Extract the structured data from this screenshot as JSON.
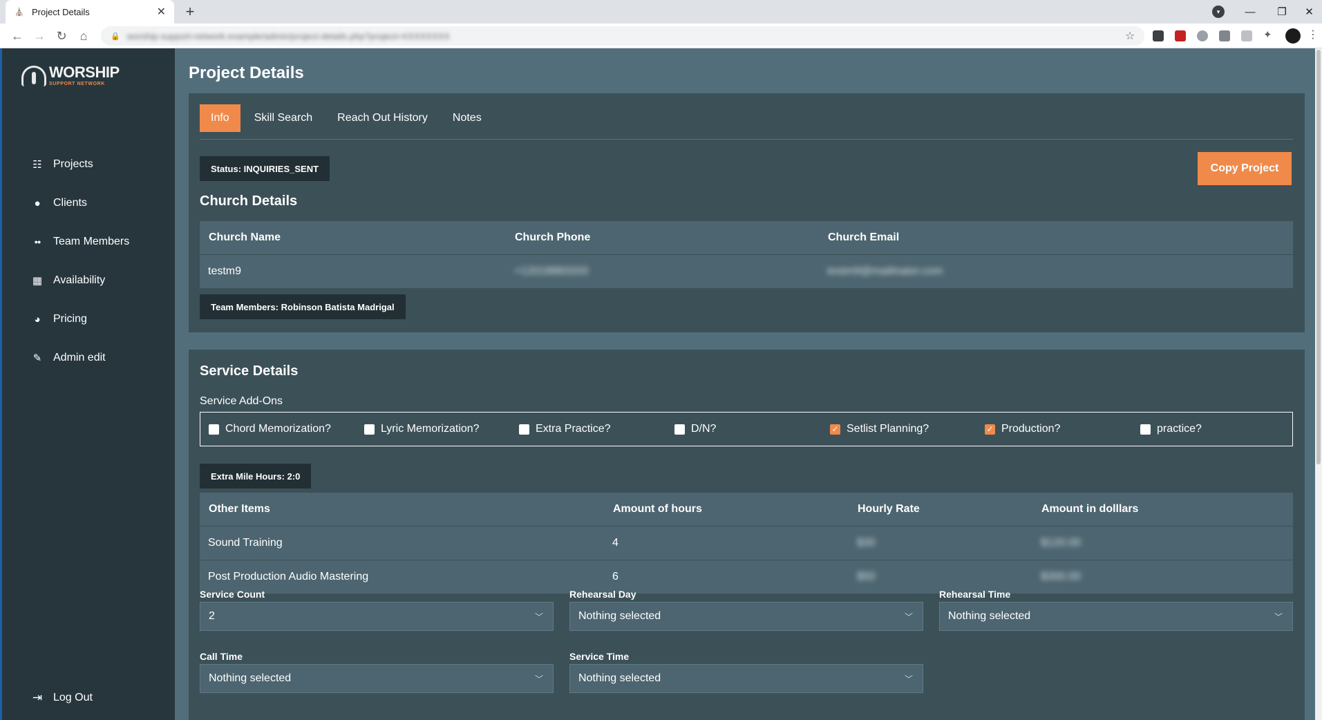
{
  "browser": {
    "tab_title": "Project Details",
    "tab_close": "✕",
    "new_tab": "+",
    "url": "worship-support-network.example/admin/project-details.php?project=XXXXXXXX",
    "window": {
      "minimize": "—",
      "restore": "❐",
      "close": "✕"
    }
  },
  "sidebar": {
    "logo_word": "WORSHIP",
    "logo_sub": "SUPPORT NETWORK",
    "items": [
      {
        "label": "Projects",
        "icon": "projects-icon",
        "glyph": "☷"
      },
      {
        "label": "Clients",
        "icon": "person-icon",
        "glyph": "●"
      },
      {
        "label": "Team Members",
        "icon": "people-icon",
        "glyph": "●●"
      },
      {
        "label": "Availability",
        "icon": "calendar-icon",
        "glyph": "▦"
      },
      {
        "label": "Pricing",
        "icon": "pie-chart-icon",
        "glyph": "◕"
      },
      {
        "label": "Admin edit",
        "icon": "pencil-icon",
        "glyph": "✎"
      }
    ],
    "logout": {
      "label": "Log Out",
      "icon": "logout-icon",
      "glyph": "⇥"
    }
  },
  "main": {
    "title": "Project Details",
    "tabs": [
      {
        "label": "Info",
        "active": true
      },
      {
        "label": "Skill Search",
        "active": false
      },
      {
        "label": "Reach Out History",
        "active": false
      },
      {
        "label": "Notes",
        "active": false
      }
    ],
    "status": "Status: INQUIRIES_SENT",
    "copy_button": "Copy Project",
    "church": {
      "title": "Church Details",
      "headers": [
        "Church Name",
        "Church Phone",
        "Church Email"
      ],
      "row": {
        "name": "testm9",
        "phone": "+12018883333",
        "email": "testm9@mailinator.com"
      }
    },
    "team_members": "Team Members: Robinson Batista Madrigal",
    "service": {
      "title": "Service Details",
      "addons_label": "Service Add-Ons",
      "addons": [
        {
          "label": "Chord Memorization?",
          "checked": false
        },
        {
          "label": "Lyric Memorization?",
          "checked": false
        },
        {
          "label": "Extra Practice?",
          "checked": false
        },
        {
          "label": "D/N?",
          "checked": false
        },
        {
          "label": "Setlist Planning?",
          "checked": true
        },
        {
          "label": "Production?",
          "checked": true
        },
        {
          "label": "practice?",
          "checked": false
        }
      ],
      "extra_mile": "Extra Mile Hours: 2:0",
      "items_headers": [
        "Other Items",
        "Amount of hours",
        "Hourly Rate",
        "Amount in dolllars"
      ],
      "items": [
        {
          "name": "Sound Training",
          "hours": "4",
          "rate": "$30",
          "amount": "$120.00"
        },
        {
          "name": "Post Production Audio Mastering",
          "hours": "6",
          "rate": "$50",
          "amount": "$300.00"
        }
      ],
      "fields": {
        "service_count": {
          "label": "Service Count",
          "value": "2"
        },
        "rehearsal_day": {
          "label": "Rehearsal Day",
          "value": "Nothing selected"
        },
        "rehearsal_time": {
          "label": "Rehearsal Time",
          "value": "Nothing selected"
        },
        "call_time": {
          "label": "Call Time",
          "value": "Nothing selected"
        },
        "service_time": {
          "label": "Service Time",
          "value": "Nothing selected"
        }
      }
    }
  },
  "colors": {
    "accent": "#f08a4b",
    "sidebar": "#27363d",
    "page": "#536e7b",
    "card": "#3c5058"
  }
}
